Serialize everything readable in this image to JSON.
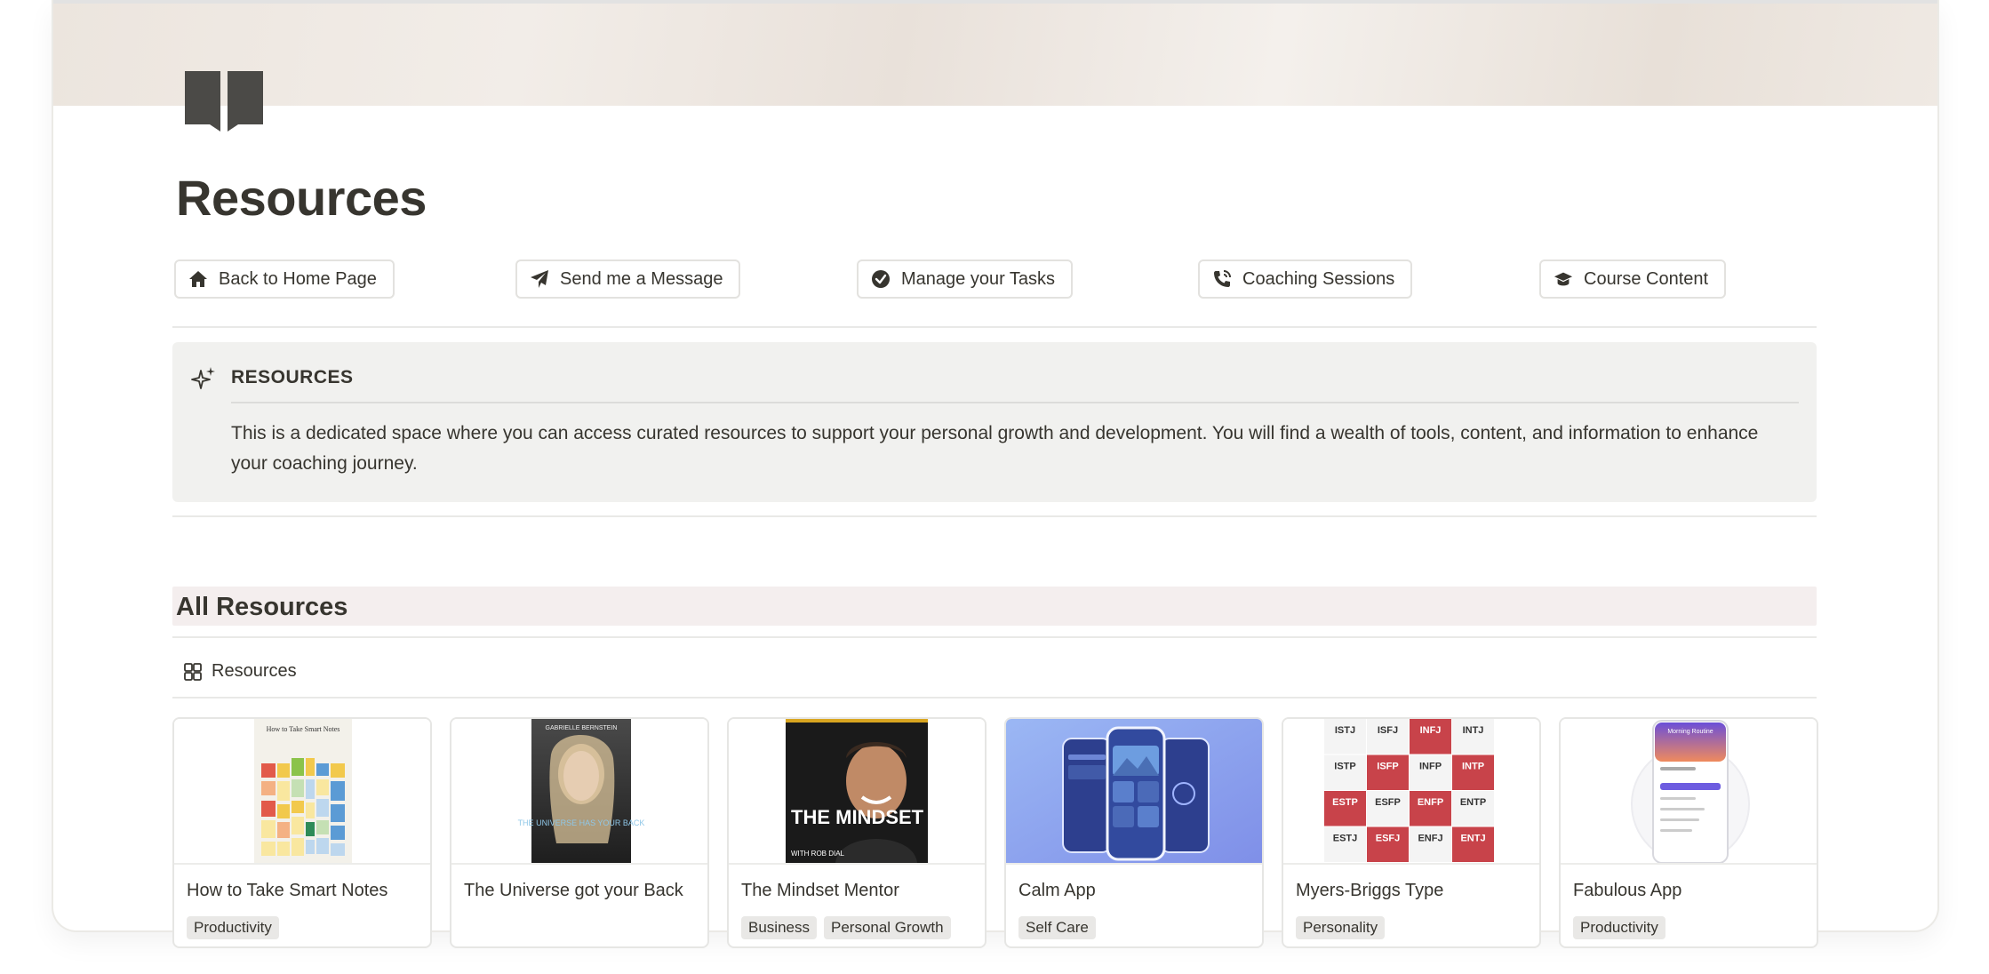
{
  "page": {
    "title": "Resources",
    "icon": "book-icon"
  },
  "nav_buttons": [
    {
      "label": "Back to Home Page",
      "icon": "home-icon"
    },
    {
      "label": "Send me a Message",
      "icon": "paper-plane-icon"
    },
    {
      "label": "Manage your Tasks",
      "icon": "check-circle-icon"
    },
    {
      "label": "Coaching Sessions",
      "icon": "phone-icon"
    },
    {
      "label": "Course Content",
      "icon": "graduation-cap-icon"
    }
  ],
  "callout": {
    "icon": "sparkles-icon",
    "title": "RESOURCES",
    "text": "This is a dedicated space where you can access curated resources to support your personal growth and development. You will find a wealth of tools, content, and information to enhance your coaching journey."
  },
  "section": {
    "heading": "All Resources",
    "view_label": "Resources",
    "view_icon": "gallery-icon"
  },
  "cards": [
    {
      "name": "How to Take Smart Notes",
      "tags": [
        "Productivity"
      ],
      "cover_text": "How to Take Smart Notes"
    },
    {
      "name": "The Universe got your Back",
      "tags": [],
      "cover_text": "THE UNIVERSE HAS YOUR BACK",
      "cover_author": "GABRIELLE BERNSTEIN"
    },
    {
      "name": "The Mindset Mentor",
      "tags": [
        "Business",
        "Personal Growth"
      ],
      "cover_text": "THE MINDSET MENTOR",
      "cover_sub": "WITH ROB DIAL"
    },
    {
      "name": "Calm App",
      "tags": [
        "Self Care"
      ]
    },
    {
      "name": "Myers-Briggs Type",
      "tags": [
        "Personality"
      ],
      "mbti": [
        "ISTJ",
        "ISFJ",
        "INFJ",
        "INTJ",
        "ISTP",
        "ISFP",
        "INFP",
        "INTP",
        "ESTP",
        "ESFP",
        "ENFP",
        "ENTP",
        "ESTJ",
        "ESFJ",
        "ENFJ",
        "ENTJ"
      ]
    },
    {
      "name": "Fabulous App",
      "tags": [
        "Productivity"
      ],
      "cover_text": "Morning Routine"
    }
  ],
  "colors": {
    "text": "#37352f",
    "callout_bg": "#f1f1ef",
    "heading_bg": "#f4eeee",
    "tag_bg": "#e9e8e6",
    "mbti_red": "#c8434a",
    "calm_blue": "#8aa8f0"
  }
}
